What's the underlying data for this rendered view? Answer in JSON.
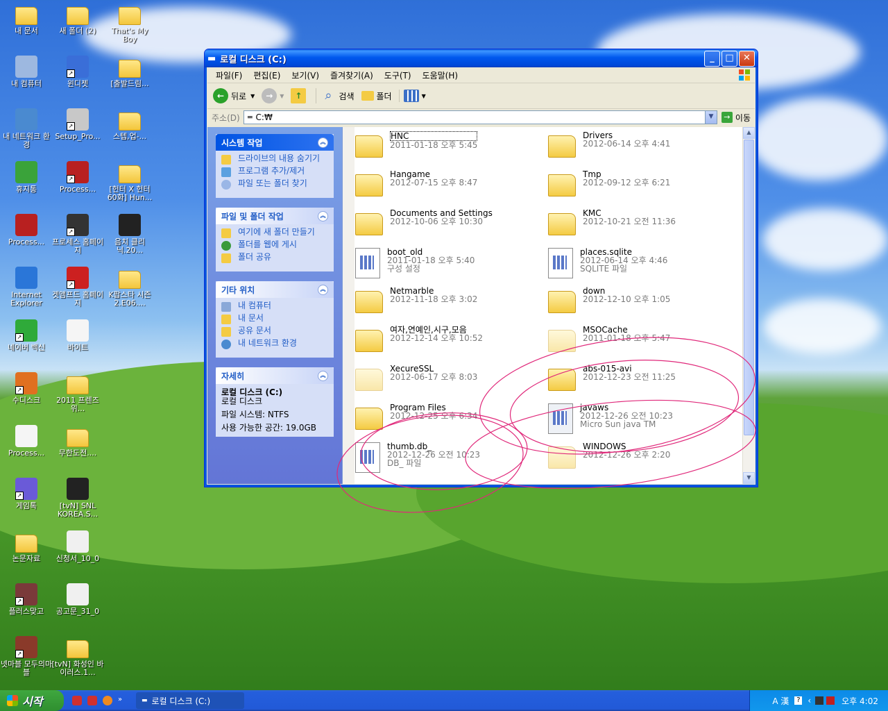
{
  "desktop": {
    "icons": [
      {
        "label": "내 문서"
      },
      {
        "label": "새 폴더 (2)"
      },
      {
        "label": "That's My Boy"
      },
      {
        "label": "내 컴퓨터"
      },
      {
        "label": "윈디젯"
      },
      {
        "label": "[출발드림..."
      },
      {
        "label": "내 네트워크 환경"
      },
      {
        "label": "Setup_Pro..."
      },
      {
        "label": "스텝,업-..."
      },
      {
        "label": "휴지통"
      },
      {
        "label": "Process..."
      },
      {
        "label": "[헌터 X 헌터 60화] Hun..."
      },
      {
        "label": "Process..."
      },
      {
        "label": "프로세스 홈페이지"
      },
      {
        "label": "음치 클리닉.20..."
      },
      {
        "label": "Internet Explorer"
      },
      {
        "label": "겟앰프드 홈페이지"
      },
      {
        "label": "K팝스타 시즌2.E06...."
      },
      {
        "label": "네이버 백신"
      },
      {
        "label": "바이트"
      },
      {
        "label": "수디스크"
      },
      {
        "label": "2011 프렌즈위..."
      },
      {
        "label": "Process..."
      },
      {
        "label": "무한도전...."
      },
      {
        "label": "게임톡"
      },
      {
        "label": "[tvN] SNL KOREA.S..."
      },
      {
        "label": "논문자료"
      },
      {
        "label": "신청서_10_0"
      },
      {
        "label": "플러스맞고"
      },
      {
        "label": "공고문_31_0"
      },
      {
        "label": "넷마블 모두의마블"
      },
      {
        "label": "[tvN] 화성인 바이러스.1..."
      }
    ]
  },
  "window": {
    "title": "로컬 디스크 (C:)",
    "menu": [
      "파일(F)",
      "편집(E)",
      "보기(V)",
      "즐겨찾기(A)",
      "도구(T)",
      "도움말(H)"
    ],
    "toolbar": {
      "back": "뒤로",
      "search": "검색",
      "folders": "폴더"
    },
    "address": {
      "label": "주소(D)",
      "value": "C:₩",
      "go": "이동"
    },
    "panels": {
      "system": {
        "title": "시스템 작업",
        "items": [
          "드라이브의 내용 숨기기",
          "프로그램 추가/제거",
          "파일 또는 폴더 찾기"
        ]
      },
      "filefolder": {
        "title": "파일 및 폴더 작업",
        "items": [
          "여기에 새 폴더 만들기",
          "폴더를 웹에 게시",
          "폴더 공유"
        ]
      },
      "other": {
        "title": "기타 위치",
        "items": [
          "내 컴퓨터",
          "내 문서",
          "공유 문서",
          "내 네트워크 환경"
        ]
      },
      "details": {
        "title": "자세히",
        "name": "로컬 디스크 (C:)",
        "type": "로컬 디스크",
        "fs": "파일 시스템: NTFS",
        "free": "사용 가능한 공간: 19.0GB"
      }
    },
    "files": [
      {
        "name": "HNC",
        "date": "2011-01-18 오후 5:45",
        "sub": ""
      },
      {
        "name": "Drivers",
        "date": "2012-06-14 오후 4:41",
        "sub": ""
      },
      {
        "name": "Hangame",
        "date": "2012-07-15 오후 8:47",
        "sub": ""
      },
      {
        "name": "Tmp",
        "date": "2012-09-12 오후 6:21",
        "sub": ""
      },
      {
        "name": "Documents and Settings",
        "date": "2012-10-06 오후 10:30",
        "sub": ""
      },
      {
        "name": "KMC",
        "date": "2012-10-21 오전 11:36",
        "sub": ""
      },
      {
        "name": "boot_old",
        "date": "2011-01-18 오후 5:40",
        "sub": "구성 설정"
      },
      {
        "name": "places.sqlite",
        "date": "2012-06-14 오후 4:46",
        "sub": "SQLITE 파일"
      },
      {
        "name": "Netmarble",
        "date": "2012-11-18 오후 3:02",
        "sub": ""
      },
      {
        "name": "down",
        "date": "2012-12-10 오후 1:05",
        "sub": ""
      },
      {
        "name": "여자,연예인,시구,모음",
        "date": "2012-12-14 오후 10:52",
        "sub": ""
      },
      {
        "name": "MSOCache",
        "date": "2011-01-18 오후 5:47",
        "sub": ""
      },
      {
        "name": "XecureSSL",
        "date": "2012-06-17 오후 8:03",
        "sub": ""
      },
      {
        "name": "abs-015-avi",
        "date": "2012-12-23 오전 11:25",
        "sub": ""
      },
      {
        "name": "Program Files",
        "date": "2012-12-25 오후 6:34",
        "sub": ""
      },
      {
        "name": "javaws",
        "date": "2012-12-26 오전 10:23",
        "sub": "Micro Sun java TM"
      },
      {
        "name": "thumb.db_",
        "date": "2012-12-26 오전 10:23",
        "sub": "DB_ 파일"
      },
      {
        "name": "WINDOWS",
        "date": "2012-12-26 오후 2:20",
        "sub": ""
      }
    ]
  },
  "taskbar": {
    "start": "시작",
    "task": "로컬 디스크 (C:)",
    "ime": "A 漢",
    "clock": "오후 4:02"
  },
  "colors": {
    "annotation": "#e0287a"
  }
}
